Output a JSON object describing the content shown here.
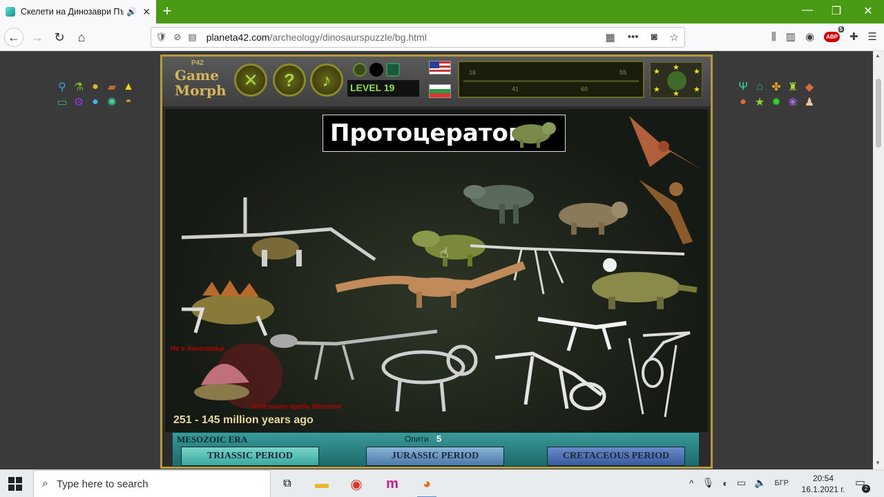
{
  "browser": {
    "tab_title": "Скелети на Динозаври Пъзел",
    "audio_icon": "speaker-icon",
    "close_glyph": "✕",
    "newtab_glyph": "+",
    "window_controls": [
      "—",
      "❐",
      "✕"
    ],
    "url_host": "planeta42.com",
    "url_path": "/archeology/dinosaurspuzzle/bg.html",
    "addon_badge": "5",
    "abp_label": "ABP"
  },
  "game": {
    "logo_tag": "P42",
    "logo_line1": "Game",
    "logo_line2": "Morph",
    "level": "LEVEL 19",
    "progress_labels": [
      "16",
      "41",
      "60",
      "55"
    ],
    "title": "Протоцератоп",
    "note_top": "Не е динозавър",
    "note_bottom": "изчезнали преди Мезозоя",
    "years": "251 - 145 million years ago",
    "era": "MESOZOIC ERA",
    "attempts_label": "Опити",
    "attempts": "5",
    "periods": [
      "TRIASSIC PERIOD",
      "JURASSIC PERIOD",
      "CRETACEOUS PERIOD"
    ]
  },
  "taskbar": {
    "search_placeholder": "Type here to search",
    "lang": "БГР",
    "time": "20:54",
    "date": "16.1.2021 г.",
    "notifications": "2"
  },
  "colors": {
    "tab_strip": "#4a9a16",
    "game_border": "#b99a3a",
    "era_bar": "#2a8a8a"
  }
}
